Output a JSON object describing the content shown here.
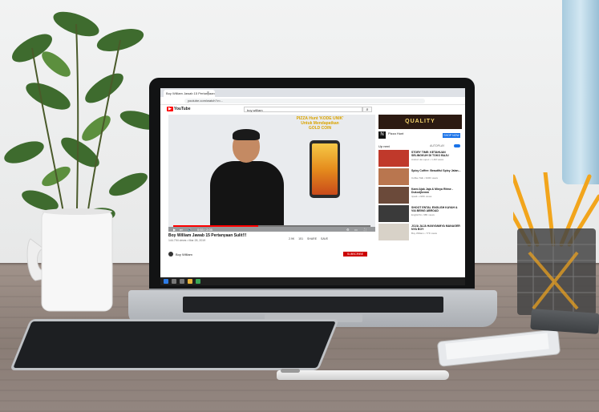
{
  "browser": {
    "tab_title": "Boy William Jawab 15 Pertanyaan Sulit...",
    "tab_close": "×",
    "url": "youtube.com/watch?v=..."
  },
  "youtube": {
    "logo_text": "YouTube",
    "logo_mark": "▶",
    "search_text": "boy william",
    "search_icon": "magnifier-icon"
  },
  "video": {
    "promo_line1": "PIZZA Hunt 'KODE UNIK'",
    "promo_line2": "Untuk Mendapatkan",
    "promo_line3": "GOLD COIN",
    "time": "0:53 / 2:05",
    "title": "Boy William Jawab 15 Pertanyaan Sulit!!!",
    "meta": "144.794 views • Mar 28, 2019",
    "actions": "2.9K  151  SHARE  SAVE",
    "channel": "Boy William",
    "subscribe": "SUBSCRIBE",
    "progress_fraction": 0.43
  },
  "sidebar": {
    "ad_banner": "QUALITY",
    "ad_logo": "N",
    "ad_name": "Pizza Hunt",
    "ad_button": "SHOP NOW",
    "up_next": "Up next",
    "autoplay": "AUTOPLAY",
    "items": [
      {
        "title": "STORY TIME: KETAHUAN SELINGKUH DI TOKO BAJU",
        "meta": "Andovi da Lopez • 1.2M views",
        "color": "#c0392b"
      },
      {
        "title": "Spicy Coffee: Beautiful Spicy Jalan...",
        "meta": "Coffee Talk • 340K views",
        "color": "#b9764f"
      },
      {
        "title": "Kami Ajak Jaja & Minya Ritme - Dukodjhemm",
        "meta": "ripadi • 220K views",
        "color": "#6b4a3a"
      },
      {
        "title": "SHOOT ENTAL ENGLISH KAYAH & VIA BEING ABROAD",
        "meta": "EnglishSi • 98K views",
        "color": "#3a3a3a"
      },
      {
        "title": "JOJA JAJA HANYANMYA MANAGER NYA BOY",
        "meta": "Boy William • 77K views",
        "color": "#d8d2c8"
      }
    ]
  },
  "accent": "#ff0000"
}
